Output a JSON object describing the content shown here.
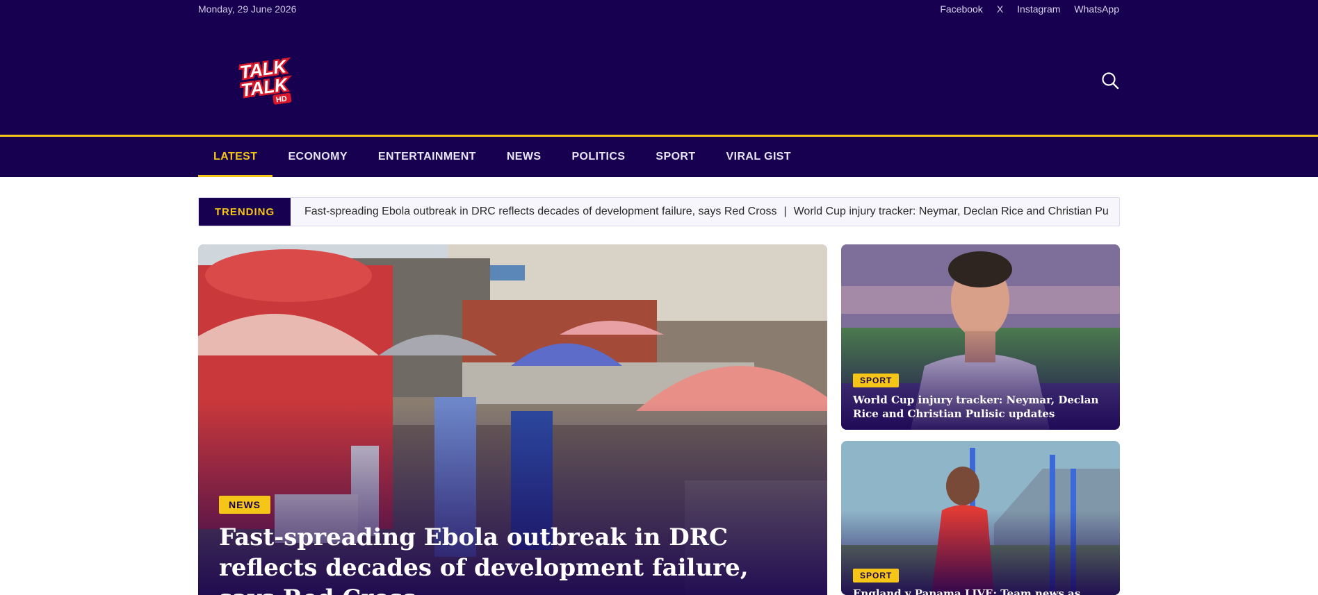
{
  "header": {
    "date": "Monday, 29 June 2026",
    "social": [
      "Facebook",
      "X",
      "Instagram",
      "WhatsApp"
    ],
    "logo_text": "TALK TALK HD",
    "search_icon": "search-icon"
  },
  "nav": {
    "items": [
      "LATEST",
      "ECONOMY",
      "ENTERTAINMENT",
      "NEWS",
      "POLITICS",
      "SPORT",
      "VIRAL GIST"
    ],
    "active": "LATEST"
  },
  "trending": {
    "label": "TRENDING",
    "headlines": [
      "Fast-spreading Ebola outbreak in DRC reflects decades of development failure, says Red Cross",
      "World Cup injury tracker: Neymar, Declan Rice and Christian Pu"
    ],
    "separator": "|"
  },
  "featured": {
    "category": "NEWS",
    "title": "Fast-spreading Ebola outbreak in DRC reflects decades of development failure, says Red Cross"
  },
  "side_cards": [
    {
      "category": "SPORT",
      "title": "World Cup injury tracker: Neymar, Declan Rice and Christian Pulisic updates"
    },
    {
      "category": "SPORT",
      "title": "England v Panama LIVE: Team news as Rece"
    }
  ],
  "colors": {
    "brand": "#170050",
    "accent": "#f5c518"
  }
}
